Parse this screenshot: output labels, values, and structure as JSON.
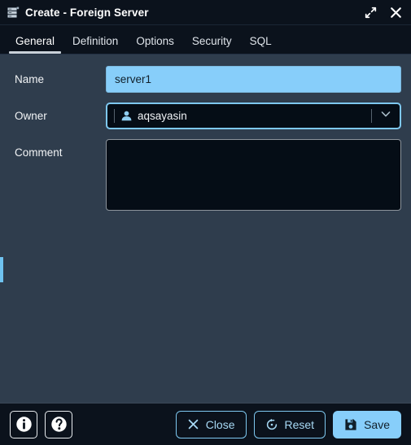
{
  "window": {
    "title": "Create - Foreign Server",
    "icon": "server-rack-icon",
    "maximize_label": "Maximize",
    "close_label": "Close"
  },
  "tabs": [
    {
      "label": "General",
      "active": true
    },
    {
      "label": "Definition",
      "active": false
    },
    {
      "label": "Options",
      "active": false
    },
    {
      "label": "Security",
      "active": false
    },
    {
      "label": "SQL",
      "active": false
    }
  ],
  "form": {
    "name": {
      "label": "Name",
      "value": "server1",
      "placeholder": ""
    },
    "owner": {
      "label": "Owner",
      "value": "aqsayasin",
      "icon": "user-icon"
    },
    "comment": {
      "label": "Comment",
      "value": "",
      "placeholder": ""
    }
  },
  "footer": {
    "info_label": "Information",
    "help_label": "Help",
    "close_label": "Close",
    "reset_label": "Reset",
    "save_label": "Save"
  },
  "colors": {
    "accent": "#87cefa",
    "panel": "#2f3d4d",
    "chrome": "#0b121c",
    "field": "#050d16",
    "border_accent": "#7ec8f0"
  }
}
